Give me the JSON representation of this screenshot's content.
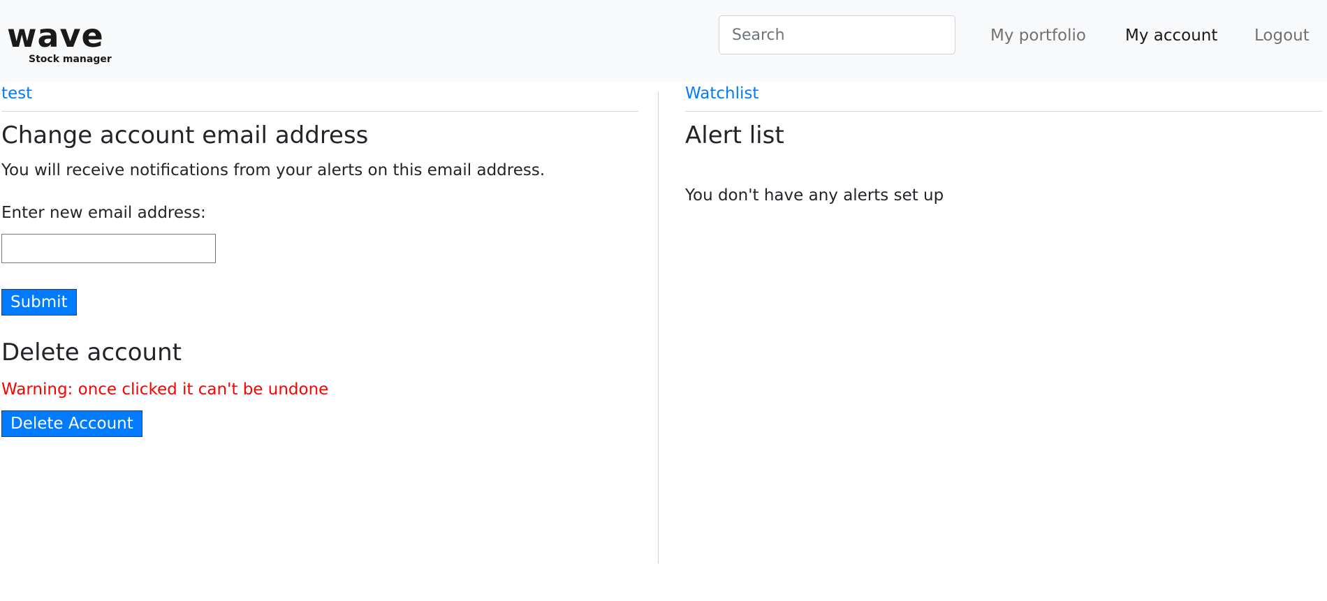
{
  "navbar": {
    "logo_word": "wave",
    "logo_subtitle": "Stock manager",
    "search_placeholder": "Search",
    "links": [
      "My portfolio",
      "My account",
      "Logout"
    ],
    "active_link": "My account"
  },
  "left": {
    "top_link": "test",
    "email_section": {
      "title": "Change account email address",
      "description": "You will receive notifications from your alerts on this email address.",
      "field_label": "Enter new email address:",
      "field_value": "",
      "submit_label": "Submit"
    },
    "delete_section": {
      "title": "Delete account",
      "warning": "Warning: once clicked it can't be undone",
      "button_label": "Delete Account"
    }
  },
  "right": {
    "top_link": "Watchlist",
    "title": "Alert list",
    "empty_message": "You don't have any alerts set up"
  },
  "colors": {
    "navbar_bg": "#f8f9fa",
    "link": "#007bff",
    "button_bg": "#007bff",
    "warning": "#ff0000"
  }
}
